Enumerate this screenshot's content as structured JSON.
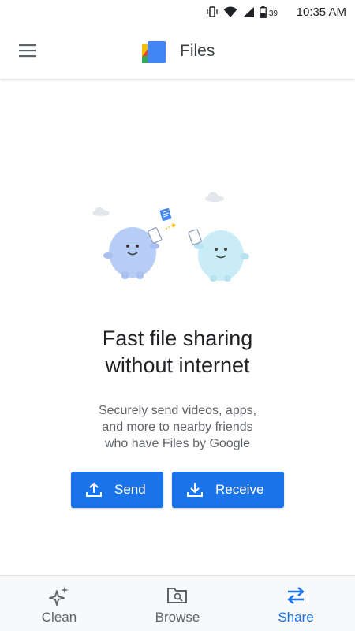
{
  "status_bar": {
    "time": "10:35 AM",
    "battery_level": "39",
    "icons": [
      "vibrate-icon",
      "wifi-icon",
      "signal-icon",
      "battery-icon"
    ]
  },
  "app_bar": {
    "title": "Files",
    "menu_icon": "hamburger-menu-icon",
    "logo_icon": "files-logo-icon"
  },
  "main": {
    "illustration": "two-characters-sharing-files",
    "headline_line1": "Fast file sharing",
    "headline_line2": "without internet",
    "description_line1": "Securely send videos, apps,",
    "description_line2": "and more to nearby friends",
    "description_line3": "who have Files by Google",
    "send_label": "Send",
    "receive_label": "Receive"
  },
  "bottom_nav": {
    "items": [
      {
        "label": "Clean",
        "icon": "sparkle-icon",
        "active": false
      },
      {
        "label": "Browse",
        "icon": "folder-search-icon",
        "active": false
      },
      {
        "label": "Share",
        "icon": "swap-arrows-icon",
        "active": true
      }
    ]
  },
  "colors": {
    "accent": "#1a73e8",
    "text_primary": "#202124",
    "text_secondary": "#5f6368",
    "nav_background": "#f8f9fa"
  }
}
